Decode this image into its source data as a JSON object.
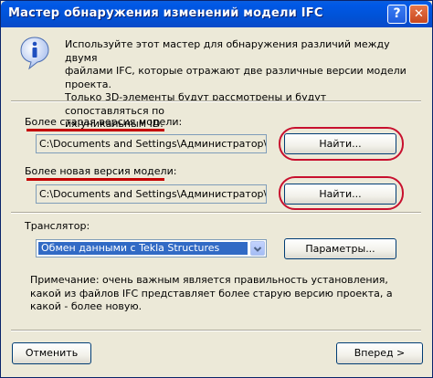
{
  "window": {
    "title": "Мастер обнаружения изменений модели IFC"
  },
  "titlebar": {
    "help_label": "?",
    "close_label": "✕"
  },
  "info": {
    "icon": "info-icon",
    "text": "Используйте этот мастер для обнаружения различий между двумя\nфайлами IFC, которые отражают две различные версии модели\nпроекта.\nТолько 3D-элементы будут рассмотрены и будут сопоставляться по\nих уникальным ID."
  },
  "old_model": {
    "label": "Более старая версия модели:",
    "path": "C:\\Documents and Settings\\Администратор\\Мои ...",
    "find_label": "Найти..."
  },
  "new_model": {
    "label": "Более новая версия модели:",
    "path": "C:\\Documents and Settings\\Администратор\\Мои ...",
    "find_label": "Найти..."
  },
  "translator": {
    "label": "Транслятор:",
    "selected": "Обмен данными с Tekla Structures",
    "params_label": "Параметры..."
  },
  "note": "Примечание: очень важным является правильность установления, какой из файлов IFC представляет более старую версию проекта, а какой - более новую.",
  "footer": {
    "cancel_label": "Отменить",
    "next_label": "Вперед >"
  },
  "colors": {
    "annotation": "#c8102e",
    "titlebar": "#0058e6",
    "dialog_bg": "#ece9d8",
    "selection": "#316ac5"
  }
}
